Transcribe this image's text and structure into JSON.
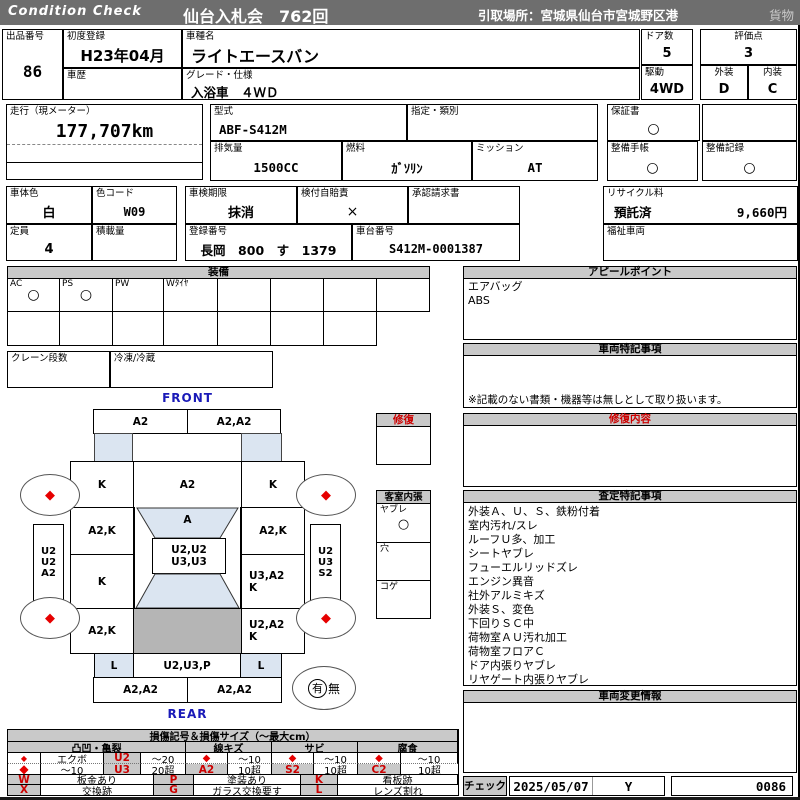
{
  "header": {
    "brand": "Condition  Check",
    "title": "仙台入札会　762回",
    "pickup": "引取場所：宮城県仙台市宮城野区港",
    "category": "貨物"
  },
  "fields": {
    "lot": {
      "label": "出品番号",
      "value": "86"
    },
    "first_reg": {
      "label": "初度登録",
      "value": "H23年04月"
    },
    "history": {
      "label": "車歴",
      "value": ""
    },
    "model": {
      "label": "車種名",
      "value": "ライトエースバン"
    },
    "grade": {
      "label": "グレード・仕様",
      "value": "入浴車　４ＷＤ"
    },
    "doors": {
      "label": "ドア数",
      "value": "5"
    },
    "score": {
      "label": "評価点",
      "value": "3"
    },
    "drive": {
      "label": "駆動",
      "value": "4WD"
    },
    "exterior": {
      "label": "外装",
      "value": "D"
    },
    "interior": {
      "label": "内装",
      "value": "C"
    },
    "mileage": {
      "label": "走行（現メーター）",
      "value": "177,707km"
    },
    "model_code": {
      "label": "型式",
      "value": "ABF-S412M"
    },
    "designation": {
      "label": "指定・類別",
      "value": ""
    },
    "warranty": {
      "label": "保証書",
      "value": "○"
    },
    "displacement": {
      "label": "排気量",
      "value": "1500CC"
    },
    "fuel": {
      "label": "燃料",
      "value": "ｶﾞｿﾘﾝ"
    },
    "transmission": {
      "label": "ミッション",
      "value": "AT"
    },
    "maintenance_book": {
      "label": "整備手帳",
      "value": "○"
    },
    "maintenance_record": {
      "label": "整備記録",
      "value": "○"
    },
    "body_color": {
      "label": "車体色",
      "value": "白"
    },
    "color_code": {
      "label": "色コード",
      "value": "W09"
    },
    "inspection": {
      "label": "車検期限",
      "value": "抹消"
    },
    "insurance": {
      "label": "検付自賠責",
      "value": "×"
    },
    "approval": {
      "label": "承認請求書",
      "value": ""
    },
    "recycle": {
      "label": "リサイクル料",
      "status": "預託済",
      "fee": "9,660円"
    },
    "capacity": {
      "label": "定員",
      "value": "4"
    },
    "load": {
      "label": "積載量",
      "value": ""
    },
    "reg_no": {
      "label": "登録番号",
      "value": "長岡　800　す　1379"
    },
    "chassis": {
      "label": "車台番号",
      "value": "S412M-0001387"
    },
    "welfare": {
      "label": "福祉車両",
      "value": ""
    }
  },
  "equipment": {
    "title": "装備",
    "row1": [
      {
        "label": "AC",
        "mark": "○"
      },
      {
        "label": "PS",
        "mark": "○"
      },
      {
        "label": "PW",
        "mark": ""
      },
      {
        "label": "Wﾀｲﾔ",
        "mark": ""
      },
      {
        "label": "",
        "mark": ""
      },
      {
        "label": "",
        "mark": ""
      },
      {
        "label": "",
        "mark": ""
      },
      {
        "label": "",
        "mark": ""
      }
    ],
    "crane_label": "クレーン段数",
    "fridge_label": "冷凍/冷蔵"
  },
  "appeal": {
    "title": "アピールポイント",
    "items": [
      "エアバッグ",
      "ABS"
    ]
  },
  "vehicle_notes": {
    "title": "車両特記事項",
    "note": "※記載のない書類・機器等は無しとして取り扱います。"
  },
  "repair_details": {
    "title": "修復内容",
    "content": ""
  },
  "assessment": {
    "title": "査定特記事項",
    "items": [
      "外装Ａ、Ｕ、Ｓ、鉄粉付着",
      "室内汚れ/スレ",
      "ルーフＵ多、加工",
      "シートヤブレ",
      "フューエルリッドズレ",
      "エンジン異音",
      "社外アルミキズ",
      "外装Ｓ、変色",
      "下回りＳＣ中",
      "荷物室ＡＵ汚れ加工",
      "荷物室フロアＣ",
      "ドア内張りヤブレ",
      "リヤゲート内張りヤブレ"
    ]
  },
  "change_info": {
    "title": "車両変更情報",
    "content": ""
  },
  "check": {
    "label": "チェック",
    "date": "2025/05/07",
    "inspector": "Y",
    "number": "0086"
  },
  "diagram": {
    "front_label": "FRONT",
    "rear_label": "REAR",
    "repair_title": "修復",
    "cabin": {
      "title": "客室内張",
      "rows": [
        {
          "label": "ヤブレ",
          "mark": "○"
        },
        {
          "label": "穴",
          "mark": ""
        },
        {
          "label": "コゲ",
          "mark": ""
        }
      ]
    },
    "panels": {
      "front_bumper_l": "A2",
      "front_bumper_r": "A2,A2",
      "fender_fl": "K",
      "hood": "A2",
      "fender_fr": "K",
      "door_fl": "A2,K",
      "windshield": "A",
      "door_fr": "A2,K",
      "sill_l": "U2\nU2\nA2",
      "sill_r": "U2\nU3\nS2",
      "roof": "U2,U2\nU3,U3",
      "door_sl": "K",
      "quarter_r1": "U3,A2\nK",
      "door_rl": "A2,K",
      "quarter_r2": "U2,A2\nK",
      "rear_glass_l": "L",
      "rear_gate": "U2,U3,P",
      "rear_glass_r": "L",
      "rear_bumper_l": "A2,A2",
      "rear_bumper_r": "A2,A2"
    },
    "spare_yes": "有",
    "spare_no": "無"
  },
  "legend": {
    "title": "損傷記号＆損傷サイズ（〜最大cm）",
    "sec_dent": "凸凹・亀裂",
    "sec_scratch": "線キズ",
    "sec_rust": "サビ",
    "sec_corrosion": "腐食",
    "dent_r1_name": "エクボ",
    "dent_r1_code": "U2",
    "dent_r1_size": "〜20",
    "dent_r2_name": "〜10",
    "dent_r2_code": "U3",
    "dent_r2_size": "20超",
    "scratch_r1_size": "〜10",
    "scratch_code": "A2",
    "scratch_r2_size": "10超",
    "rust_r1_size": "〜10",
    "rust_code": "S2",
    "rust_r2_size": "10超",
    "corr_r1_size": "〜10",
    "corr_code": "C2",
    "corr_r2_size": "10超",
    "w_code": "W",
    "w_label": "板金あり",
    "p_code": "P",
    "p_label": "塗装あり",
    "k_code": "K",
    "k_label": "看板跡",
    "x_code": "X",
    "x_label": "交換跡",
    "g_code": "G",
    "g_label": "ガラス交換要す",
    "l_code": "L",
    "l_label": "レンズ割れ"
  }
}
